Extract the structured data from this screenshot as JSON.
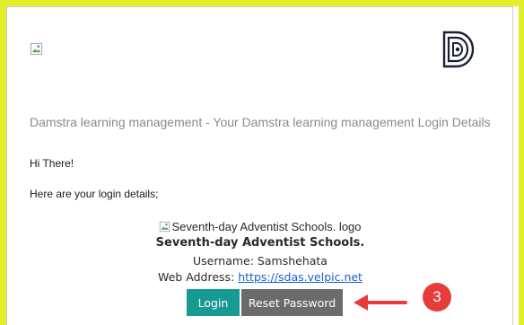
{
  "email": {
    "subject": "Damstra learning management - Your Damstra learning management Login Details",
    "greeting": "Hi There!",
    "intro": "Here are your login details;",
    "school_logo_alt": "Seventh-day Adventist Schools. logo",
    "school_name": "Seventh-day Adventist Schools.",
    "username_line": "Username: Samshehata",
    "web_address_label": "Web Address: ",
    "web_address_link": "https://sdas.velpic.net",
    "login_button": "Login",
    "reset_button": "Reset Password"
  },
  "annotation": {
    "step_number": "3",
    "accent_color": "#e63c3c"
  },
  "colors": {
    "frame": "#e4ee2a",
    "login_button": "#179a92",
    "reset_button": "#6b6b6b",
    "link": "#1a5fd6"
  },
  "icons": {
    "broken_image": "broken-image-icon",
    "brand_logo": "damstra-logo-icon",
    "arrow": "red-arrow-icon"
  }
}
